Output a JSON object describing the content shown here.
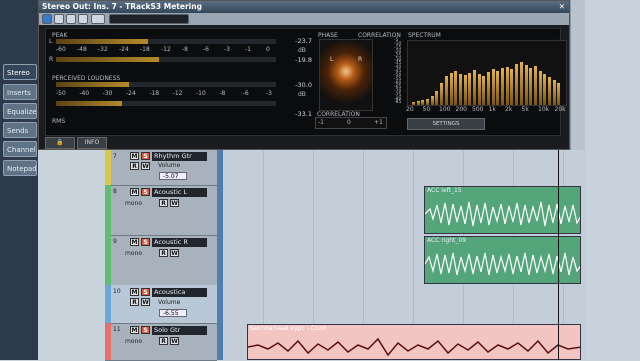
{
  "window": {
    "title": "Stereo Out: Ins. 7 - TRackS3 Metering",
    "close": "✕"
  },
  "inspector": {
    "items": [
      {
        "label": "Stereo",
        "selected": true
      },
      {
        "label": "Inserts"
      },
      {
        "label": "Equalizers"
      },
      {
        "label": "Sends"
      },
      {
        "label": "Channel"
      },
      {
        "label": "Notepad"
      }
    ]
  },
  "meter": {
    "peak_label": "PEAK",
    "perceived_label": "PERCEIVED LOUDNESS",
    "rms_label": "RMS",
    "channel_l": "L",
    "channel_r": "R",
    "db_unit": "dB",
    "peak_ticks": [
      "-60",
      "-48",
      "-32",
      "-24",
      "-18",
      "-12",
      "-8",
      "-6",
      "-3",
      "-1",
      "0"
    ],
    "loud_ticks": [
      "-50",
      "-40",
      "-30",
      "-24",
      "-18",
      "-12",
      "-10",
      "-8",
      "-6",
      "-3"
    ],
    "peak_l_value": "-23.7",
    "peak_r_value": "-19.8",
    "loud_value": "-30.0",
    "rms_value": "-33.1",
    "peak_l_fill": 0.42,
    "peak_r_fill": 0.47,
    "loud_fill": 0.33,
    "rms_fill": 0.3
  },
  "phase": {
    "label": "PHASE",
    "l": "L",
    "r": "R"
  },
  "correlation": {
    "label": "CORRELATION",
    "min": "-1",
    "mid": "0",
    "max": "+1"
  },
  "spectrum": {
    "label": "SPECTRUM",
    "db_ticks": [
      "-5",
      "-10",
      "-15",
      "-20",
      "-25",
      "-30",
      "-35",
      "-40",
      "-45",
      "-50",
      "-55",
      "-60",
      "-65",
      "-70",
      "-75",
      "-80",
      "-85"
    ],
    "freq_ticks": [
      "20",
      "50",
      "100",
      "200",
      "500",
      "1k",
      "2k",
      "5k",
      "10k",
      "20k"
    ],
    "levels": [
      0.05,
      0.06,
      0.08,
      0.1,
      0.14,
      0.22,
      0.35,
      0.46,
      0.52,
      0.55,
      0.5,
      0.48,
      0.52,
      0.56,
      0.5,
      0.47,
      0.53,
      0.58,
      0.55,
      0.6,
      0.62,
      0.58,
      0.66,
      0.7,
      0.64,
      0.6,
      0.63,
      0.55,
      0.5,
      0.45,
      0.4,
      0.36
    ]
  },
  "buttons": {
    "settings": "SETTINGS",
    "info": "INFO",
    "lock": "🔒"
  },
  "tracks": [
    {
      "num": "7",
      "name": "Rhythm Gtr",
      "mode": "",
      "volume_label": "Volume",
      "volume": "-5.07",
      "color": "#d8c94a"
    },
    {
      "num": "8",
      "name": "Acoustic L",
      "mode": "mono",
      "color": "#5fbe72"
    },
    {
      "num": "9",
      "name": "Acoustic R",
      "mode": "mono",
      "color": "#5fbe72"
    },
    {
      "num": "10",
      "name": "Acoustica",
      "mode": "",
      "volume_label": "Volume",
      "volume": "-6.55",
      "color": "#6aa8d8"
    },
    {
      "num": "11",
      "name": "Solo Gtr",
      "mode": "mono",
      "color": "#e7706a"
    }
  ],
  "clips": {
    "acc_left": "ACC left_15",
    "acc_right": "ACC right_09",
    "solo": "Бесплатный курс - Соло"
  },
  "track_buttons": {
    "mute": "M",
    "solo": "S",
    "read": "R",
    "write": "W"
  }
}
